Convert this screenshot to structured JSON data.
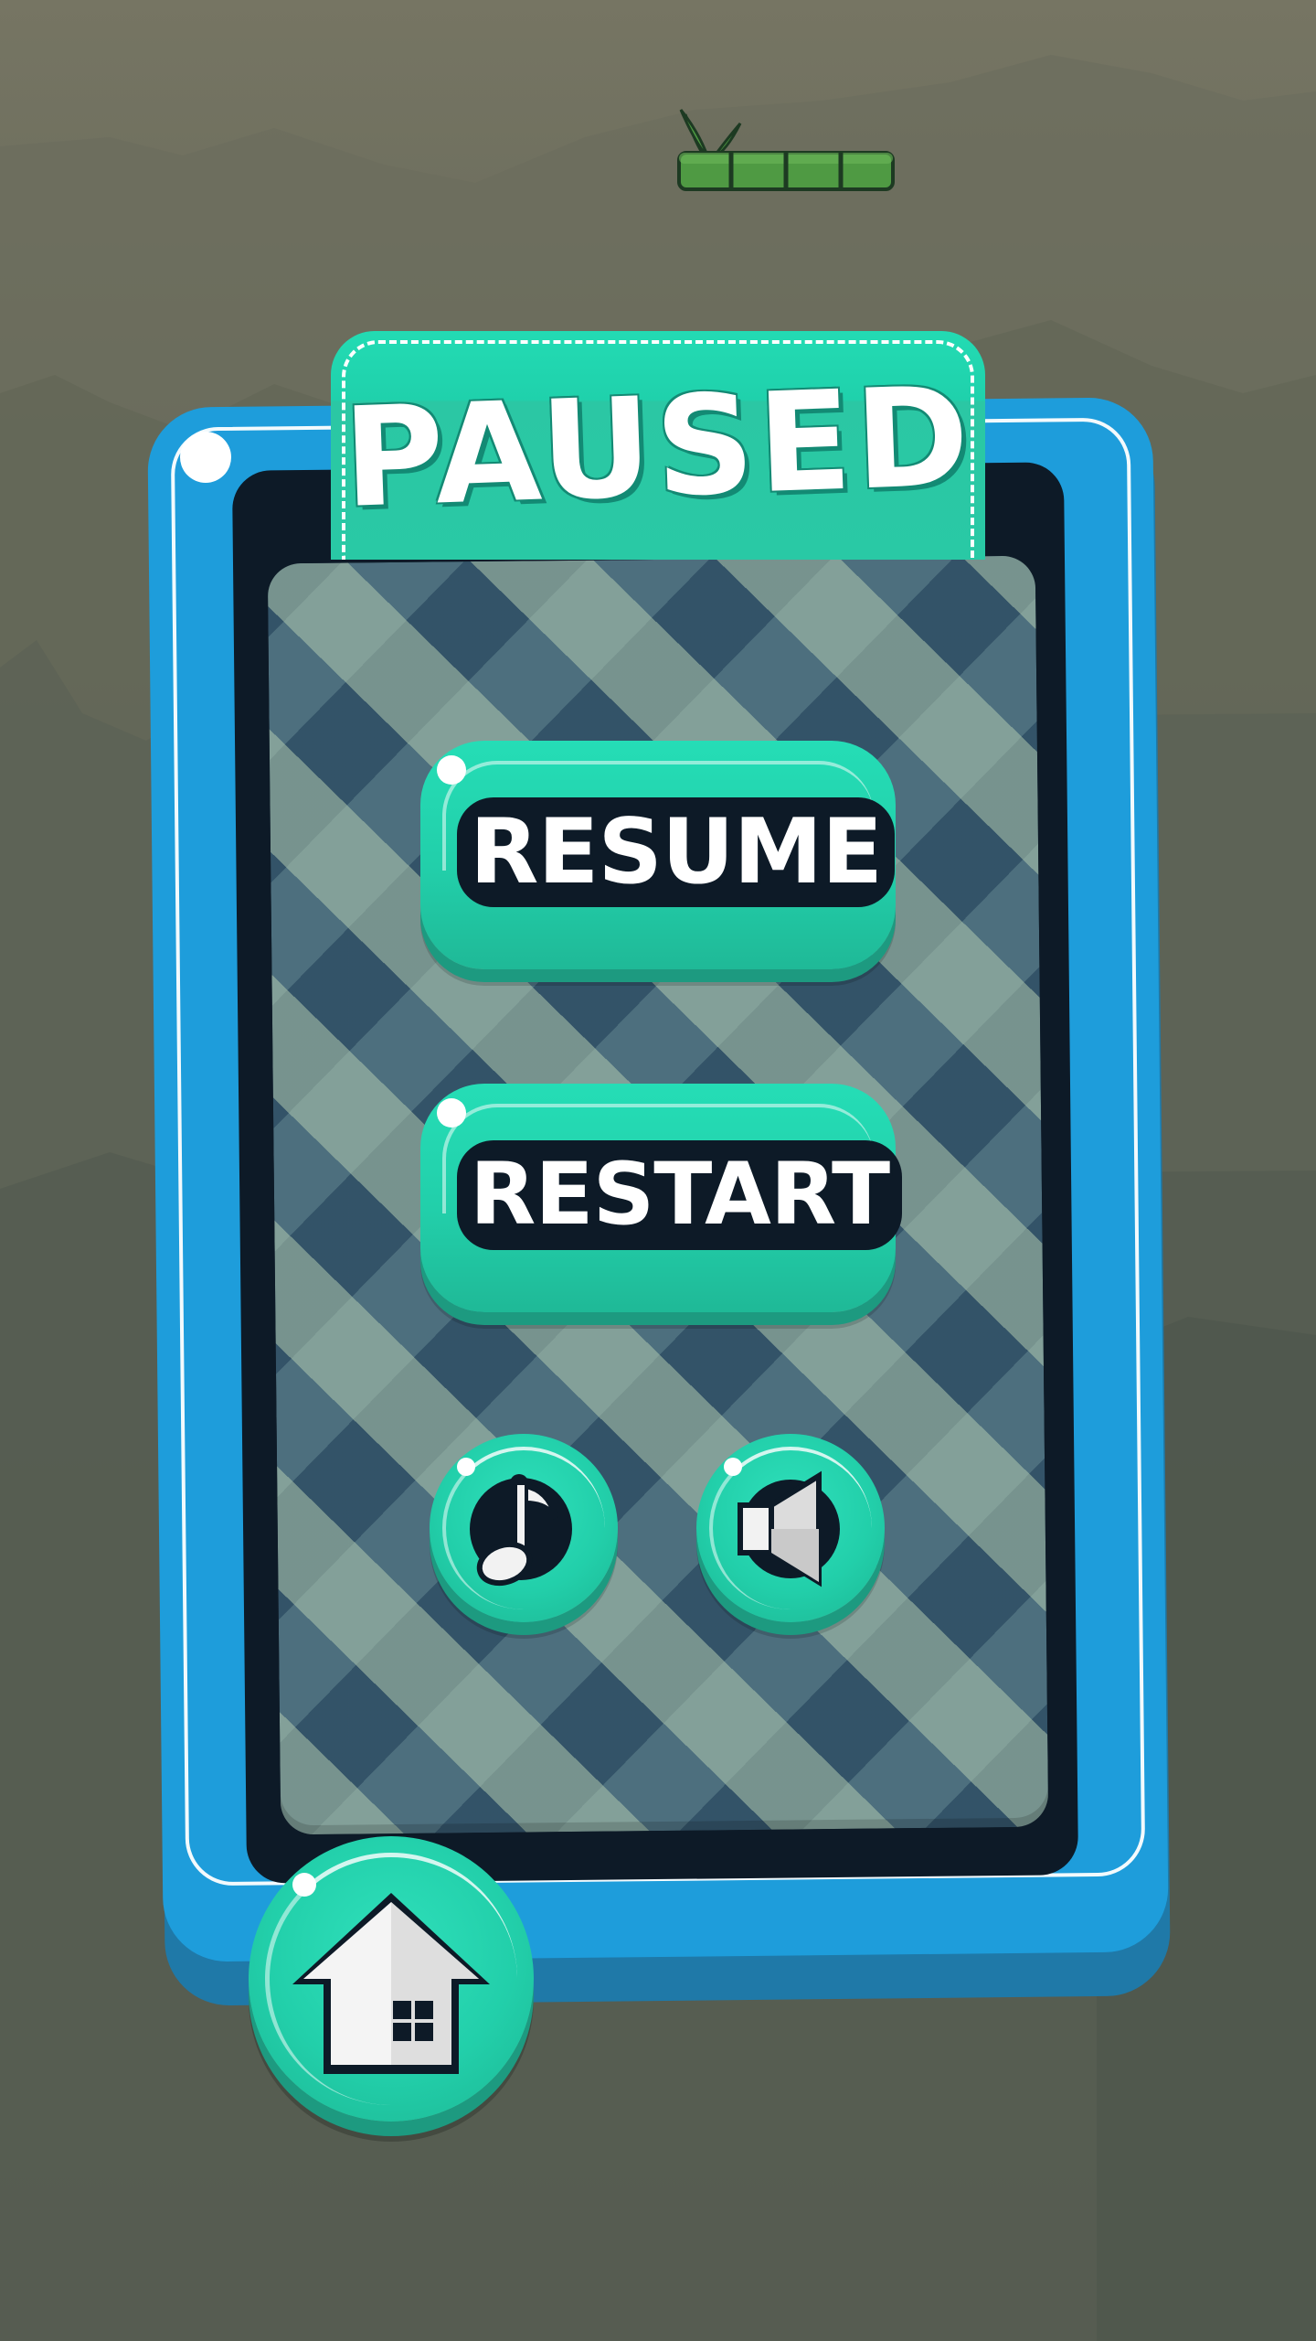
{
  "screen": {
    "title": "PAUSED"
  },
  "buttons": {
    "resume_label": "RESUME",
    "restart_label": "RESTART"
  },
  "icons": {
    "music": "music-note-icon",
    "sound": "speaker-icon",
    "home": "home-icon",
    "decoration": "bamboo-icon"
  },
  "colors": {
    "frame_blue": "#1e9ddb",
    "button_teal": "#22cfaa",
    "dark_navy": "#0d1a27"
  }
}
